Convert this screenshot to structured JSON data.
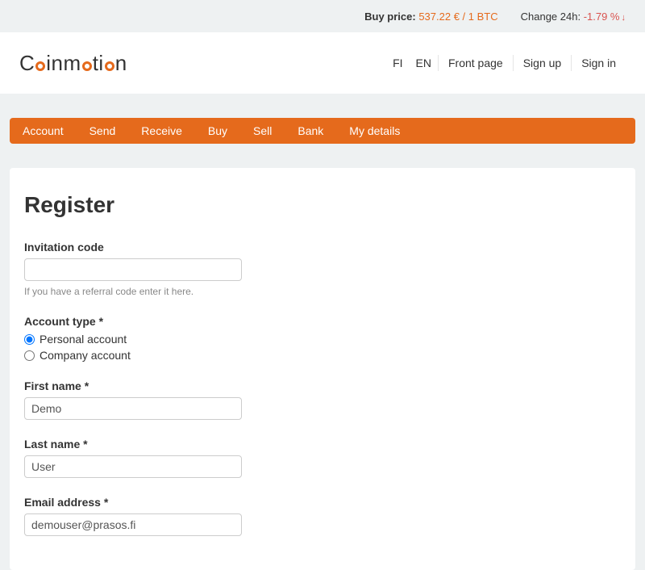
{
  "top_bar": {
    "buy_price_label": "Buy price:",
    "buy_price_value": "537.22 € / 1 BTC",
    "change_label": "Change 24h:",
    "change_value": "-1.79 %"
  },
  "logo": {
    "part1": "C",
    "part2": "inm",
    "part3": "ti",
    "part4": "n"
  },
  "header_nav": {
    "lang_fi": "FI",
    "lang_en": "EN",
    "front_page": "Front page",
    "sign_up": "Sign up",
    "sign_in": "Sign in"
  },
  "tabs": [
    "Account",
    "Send",
    "Receive",
    "Buy",
    "Sell",
    "Bank",
    "My details"
  ],
  "form": {
    "title": "Register",
    "invitation": {
      "label": "Invitation code",
      "value": "",
      "hint": "If you have a referral code enter it here."
    },
    "account_type": {
      "label": "Account type *",
      "personal": "Personal account",
      "company": "Company account",
      "selected": "personal"
    },
    "first_name": {
      "label": "First name *",
      "value": "Demo"
    },
    "last_name": {
      "label": "Last name *",
      "value": "User"
    },
    "email": {
      "label": "Email address *",
      "value": "demouser@prasos.fi"
    }
  }
}
